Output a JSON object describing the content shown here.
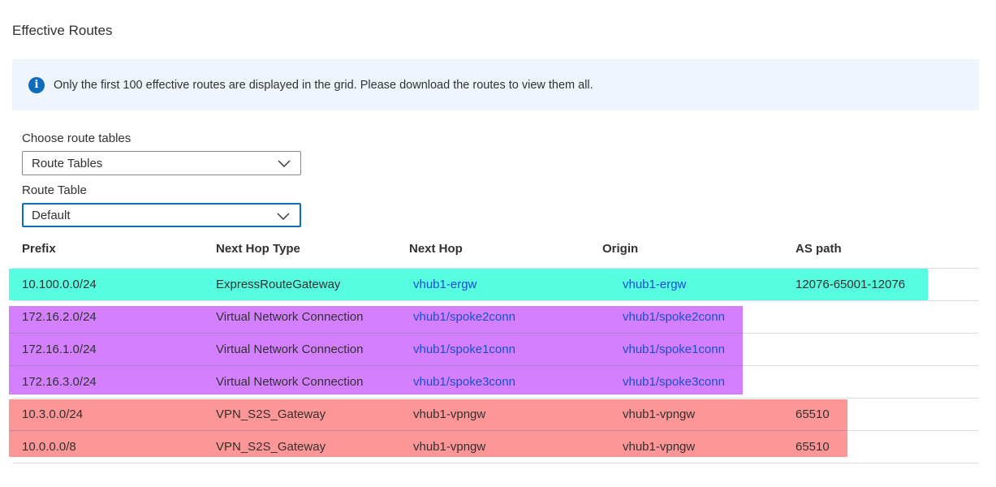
{
  "page": {
    "title": "Effective Routes"
  },
  "info": {
    "message": "Only the first 100 effective routes are displayed in the grid. Please download the routes to view them all."
  },
  "filters": {
    "route_tables_label": "Choose route tables",
    "route_tables_value": "Route Tables",
    "route_table_label": "Route Table",
    "route_table_value": "Default"
  },
  "table": {
    "columns": [
      "Prefix",
      "Next Hop Type",
      "Next Hop",
      "Origin",
      "AS path"
    ],
    "rows": [
      {
        "prefix": "10.100.0.0/24",
        "next_hop_type": "ExpressRouteGateway",
        "next_hop": "vhub1-ergw",
        "origin": "vhub1-ergw",
        "as_path": "12076-65001-12076"
      },
      {
        "prefix": "172.16.2.0/24",
        "next_hop_type": "Virtual Network Connection",
        "next_hop": "vhub1/spoke2conn",
        "origin": "vhub1/spoke2conn",
        "as_path": ""
      },
      {
        "prefix": "172.16.1.0/24",
        "next_hop_type": "Virtual Network Connection",
        "next_hop": "vhub1/spoke1conn",
        "origin": "vhub1/spoke1conn",
        "as_path": ""
      },
      {
        "prefix": "172.16.3.0/24",
        "next_hop_type": "Virtual Network Connection",
        "next_hop": "vhub1/spoke3conn",
        "origin": "vhub1/spoke3conn",
        "as_path": ""
      },
      {
        "prefix": "10.3.0.0/24",
        "next_hop_type": "VPN_S2S_Gateway",
        "next_hop": "vhub1-vpngw",
        "origin": "vhub1-vpngw",
        "as_path": "65510"
      },
      {
        "prefix": "10.0.0.0/8",
        "next_hop_type": "VPN_S2S_Gateway",
        "next_hop": "vhub1-vpngw",
        "origin": "vhub1-vpngw",
        "as_path": "65510"
      }
    ]
  },
  "colors": {
    "highlight_expressroute": "#56fde0",
    "highlight_vnet": "#d47ffd",
    "highlight_vpn": "#fd9696",
    "link": "#1a4fcf",
    "info_icon": "#0f6cbd"
  },
  "icons": {
    "info": "info-icon",
    "dropdown": "chevron-down-icon"
  }
}
